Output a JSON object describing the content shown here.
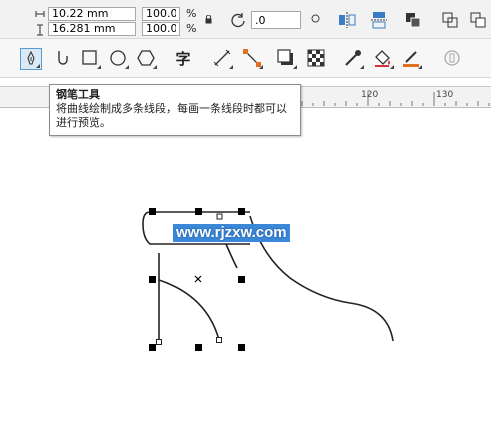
{
  "property_bar": {
    "width_value": "10.22 mm",
    "height_value": "16.281 mm",
    "scale_x": "100.0",
    "scale_y": "100.0",
    "percent": "%",
    "rotation_value": ".0",
    "icons": [
      "width-arrow-icon",
      "height-arrow-icon",
      "lock-icon",
      "rotate-icon",
      "circle-icon",
      "mirror-horizontal-icon",
      "mirror-vertical-icon",
      "arrange-icon",
      "weld-icon",
      "trim-icon"
    ]
  },
  "toolbar": {
    "tools": [
      "pen-tool",
      "hook-tool",
      "rectangle-tool",
      "ellipse-tool",
      "polygon-tool",
      "text-tool",
      "dimension-tool",
      "connector-tool",
      "drop-shadow-tool",
      "transparency-tool",
      "eyedropper-tool",
      "fill-tool",
      "outline-tool",
      "lock-tool"
    ],
    "active_tool": "pen-tool",
    "text_tool_glyph": "字"
  },
  "ruler": {
    "labels": [
      "120",
      "130"
    ]
  },
  "tooltip": {
    "title": "钢笔工具",
    "body": "将曲线绘制成多条线段，每画一条线段时都可以进行预览。"
  },
  "watermark": {
    "text": "www.rjzxw.com"
  },
  "colors": {
    "accent": "#5b9bd5",
    "watermark_bg": "#3b88d8",
    "handle": "#000000"
  }
}
